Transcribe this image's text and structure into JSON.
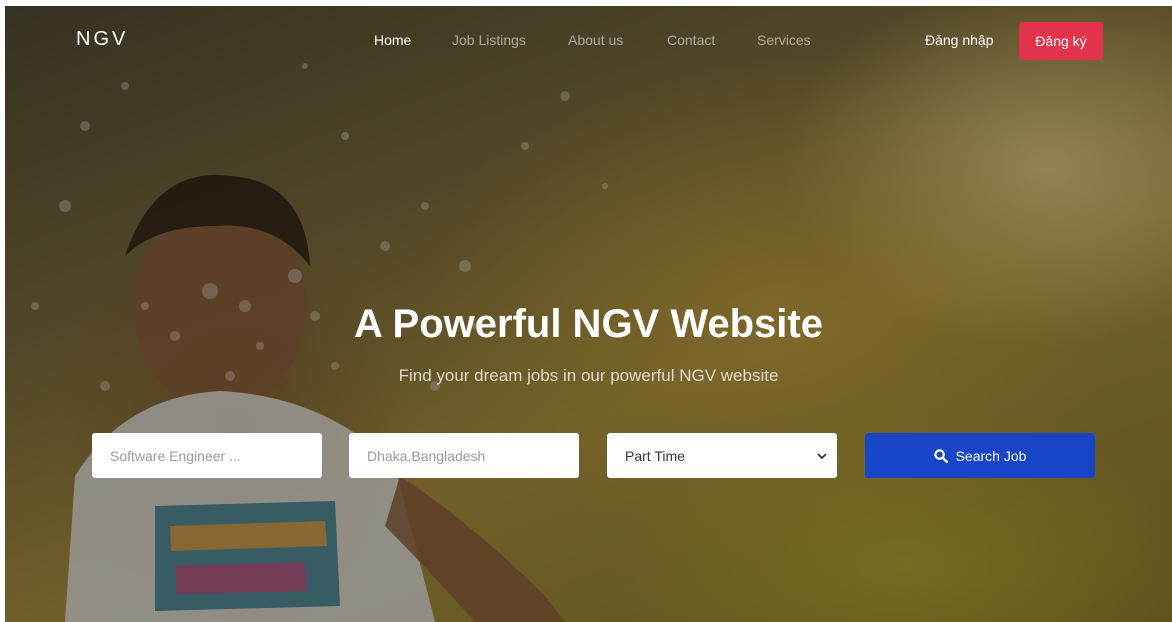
{
  "brand": {
    "logo": "NGV"
  },
  "nav": {
    "items": [
      {
        "label": "Home",
        "active": true
      },
      {
        "label": "Job Listings",
        "active": false
      },
      {
        "label": "About us",
        "active": false
      },
      {
        "label": "Contact",
        "active": false
      },
      {
        "label": "Services",
        "active": false
      }
    ],
    "login_label": "Đăng nhập",
    "signup_label": "Đăng ký"
  },
  "hero": {
    "title": "A Powerful NGV Website",
    "subtitle": "Find your dream jobs in our powerful NGV website"
  },
  "search": {
    "keyword_placeholder": "Software Engineer ...",
    "location_placeholder": "Dhaka,Bangladesh",
    "job_type_selected": "Part Time",
    "button_label": "Search Job",
    "button_icon": "search-icon"
  },
  "colors": {
    "signup_button": "#e2334a",
    "search_button": "#1845c8"
  }
}
